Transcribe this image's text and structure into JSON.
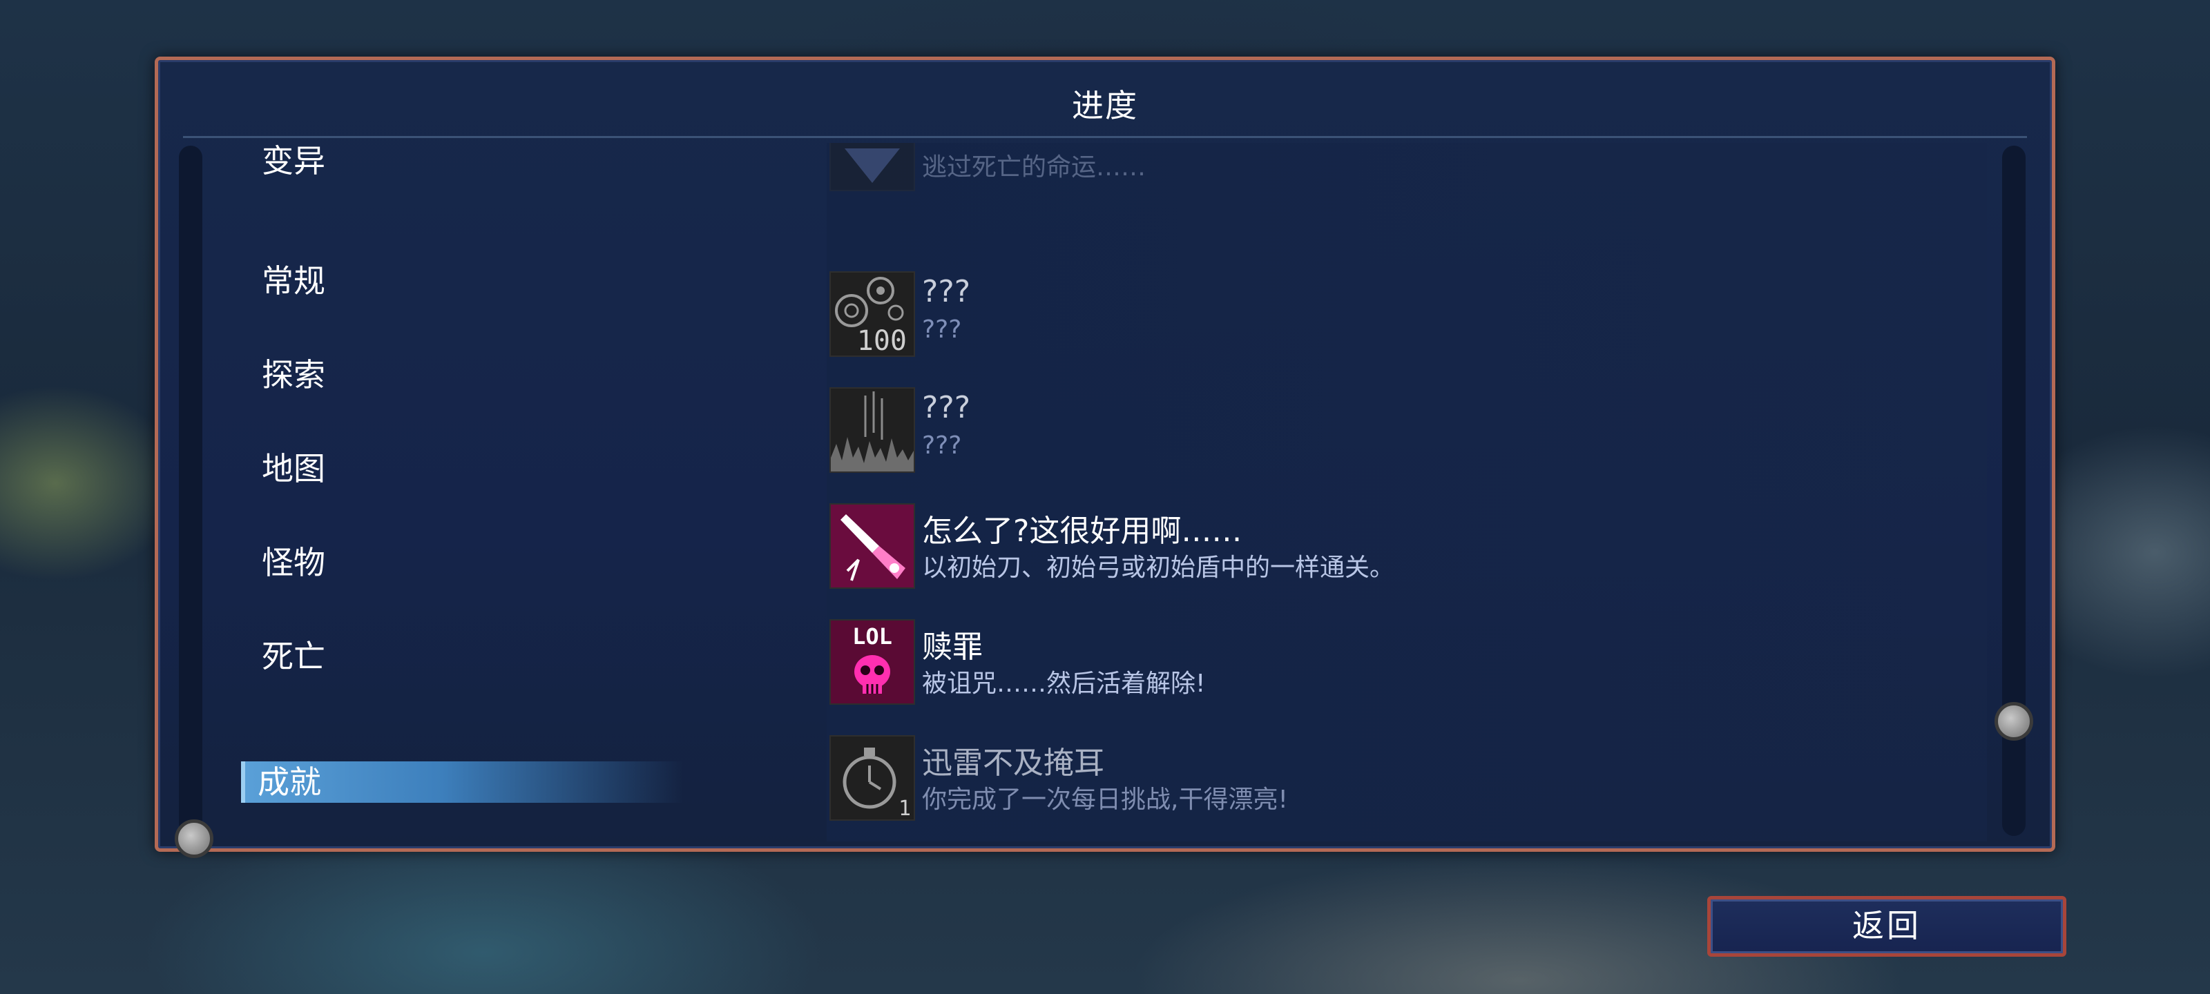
{
  "panel": {
    "title": "进度"
  },
  "categories": [
    {
      "label": "变异",
      "active": false
    },
    {
      "label": "常规",
      "active": false
    },
    {
      "label": "探索",
      "active": false
    },
    {
      "label": "地图",
      "active": false
    },
    {
      "label": "怪物",
      "active": false
    },
    {
      "label": "死亡",
      "active": false
    },
    {
      "label": "成就",
      "active": true
    }
  ],
  "achievements": [
    {
      "title": "",
      "desc": "逃过死亡的命运……",
      "state": "partial",
      "icon": "faded-achievement-icon"
    },
    {
      "title": "???",
      "desc": "???",
      "state": "locked",
      "icon": "orbs-100-icon",
      "icon_text": "100"
    },
    {
      "title": "???",
      "desc": "???",
      "state": "locked",
      "icon": "spikes-icon"
    },
    {
      "title": "怎么了?这很好用啊……",
      "desc": "以初始刀、初始弓或初始盾中的一样通关。",
      "state": "unlocked",
      "icon": "starter-sword-icon"
    },
    {
      "title": "赎罪",
      "desc": "被诅咒……然后活着解除!",
      "state": "unlocked",
      "icon": "lol-skull-icon",
      "icon_text": "LOL"
    },
    {
      "title": "迅雷不及掩耳",
      "desc": "你完成了一次每日挑战,干得漂亮!",
      "state": "gray",
      "icon": "stopwatch-icon",
      "icon_text": "1"
    },
    {
      "title": "???",
      "desc": "",
      "state": "partial",
      "icon": "locked-icon"
    }
  ],
  "footer": {
    "back_label": "返回"
  },
  "colors": {
    "accent_frame": "#b46a55",
    "panel_bg": "#17284a",
    "active_tab": "#5aa0d8",
    "icon_magenta": "#e0208c"
  }
}
